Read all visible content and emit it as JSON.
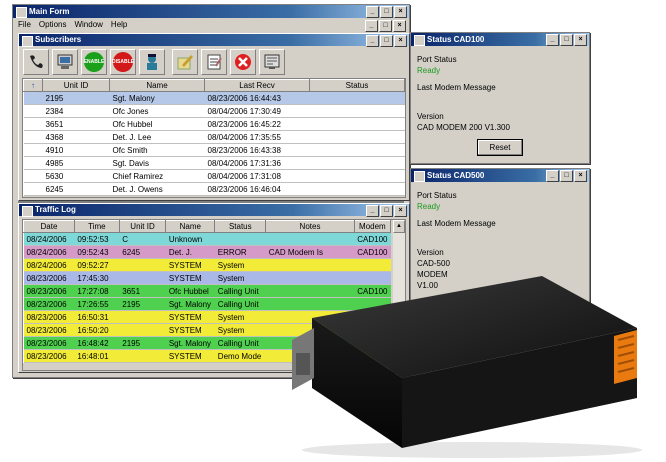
{
  "main_form": {
    "title": "Main Form",
    "menu": [
      "File",
      "Options",
      "Window",
      "Help"
    ]
  },
  "subscribers": {
    "title": "Subscribers",
    "toolbar": [
      "phone-icon",
      "computer-icon",
      "enable-icon",
      "disable-icon",
      "police-icon",
      "pencil-box-icon",
      "notepad-icon",
      "delete-icon",
      "monitor-icon"
    ],
    "enable_label": "ENABLE",
    "disable_label": "DISABLE",
    "columns": [
      "Unit ID",
      "Name",
      "Last Recv",
      "Status"
    ],
    "rows": [
      {
        "id": "2195",
        "name": "Sgt. Malony",
        "recv": "08/23/2006 16:44:43",
        "status": ""
      },
      {
        "id": "2384",
        "name": "Ofc Jones",
        "recv": "08/04/2006 17:30:49",
        "status": ""
      },
      {
        "id": "3651",
        "name": "Ofc Hubbel",
        "recv": "08/23/2006 16:45:22",
        "status": ""
      },
      {
        "id": "4368",
        "name": "Det. J. Lee",
        "recv": "08/04/2006 17:35:55",
        "status": ""
      },
      {
        "id": "4910",
        "name": "Ofc Smith",
        "recv": "08/23/2006 16:43:38",
        "status": ""
      },
      {
        "id": "4985",
        "name": "Sgt. Davis",
        "recv": "08/04/2006 17:31:36",
        "status": ""
      },
      {
        "id": "5630",
        "name": "Chief Ramirez",
        "recv": "08/04/2006 17:31:08",
        "status": ""
      },
      {
        "id": "6245",
        "name": "Det. J. Owens",
        "recv": "08/23/2006 16:46:04",
        "status": ""
      }
    ]
  },
  "traffic_log": {
    "title": "Traffic Log",
    "columns": [
      "Date",
      "Time",
      "Unit ID",
      "Name",
      "Status",
      "Notes",
      "Modem"
    ],
    "rows": [
      {
        "date": "08/24/2006",
        "time": "09:52:53",
        "unit": "C",
        "name": "Unknown",
        "status": "",
        "notes": "",
        "modem": "CAD100",
        "color": "cyan"
      },
      {
        "date": "08/24/2006",
        "time": "09:52:43",
        "unit": "6245",
        "name": "Det. J.",
        "status": "ERROR",
        "notes": "CAD Modem Is",
        "modem": "CAD100",
        "color": "pink"
      },
      {
        "date": "08/24/2006",
        "time": "09:52:27",
        "unit": "",
        "name": "SYSTEM",
        "status": "System",
        "notes": "",
        "modem": "",
        "color": "yellow"
      },
      {
        "date": "08/23/2006",
        "time": "17:45:30",
        "unit": "",
        "name": "SYSTEM",
        "status": "System",
        "notes": "",
        "modem": "",
        "color": "lav"
      },
      {
        "date": "08/23/2006",
        "time": "17:27:08",
        "unit": "3651",
        "name": "Ofc Hubbel",
        "status": "Calling Unit",
        "notes": "",
        "modem": "CAD100",
        "color": "grn"
      },
      {
        "date": "08/23/2006",
        "time": "17:26:55",
        "unit": "2195",
        "name": "Sgt. Malony",
        "status": "Calling Unit",
        "notes": "",
        "modem": "",
        "color": "grn"
      },
      {
        "date": "08/23/2006",
        "time": "16:50:31",
        "unit": "",
        "name": "SYSTEM",
        "status": "System",
        "notes": "",
        "modem": "",
        "color": "yellow"
      },
      {
        "date": "08/23/2006",
        "time": "16:50:20",
        "unit": "",
        "name": "SYSTEM",
        "status": "System",
        "notes": "",
        "modem": "",
        "color": "yellow"
      },
      {
        "date": "08/23/2006",
        "time": "16:48:42",
        "unit": "2195",
        "name": "Sgt. Malony",
        "status": "Calling Unit",
        "notes": "",
        "modem": "",
        "color": "grn"
      },
      {
        "date": "08/23/2006",
        "time": "16:48:01",
        "unit": "",
        "name": "SYSTEM",
        "status": "Demo Mode",
        "notes": "",
        "modem": "",
        "color": "yellow"
      }
    ]
  },
  "status_cad100": {
    "title": "Status CAD100",
    "port_label": "Port Status",
    "port_value": "Ready",
    "modem_msg_label": "Last Modem Message",
    "version_label": "Version",
    "version_value": "CAD MODEM 200 V1.300",
    "reset_label": "Reset"
  },
  "status_cad500": {
    "title": "Status CAD500",
    "port_label": "Port Status",
    "port_value": "Ready",
    "modem_msg_label": "Last Modem Message",
    "version_label": "Version",
    "version_line1": "CAD-500",
    "version_line2": "MODEM",
    "version_line3": "V1.00"
  },
  "colors": {
    "ready": "#1c9a1c",
    "titlebar": "#0a246a"
  }
}
